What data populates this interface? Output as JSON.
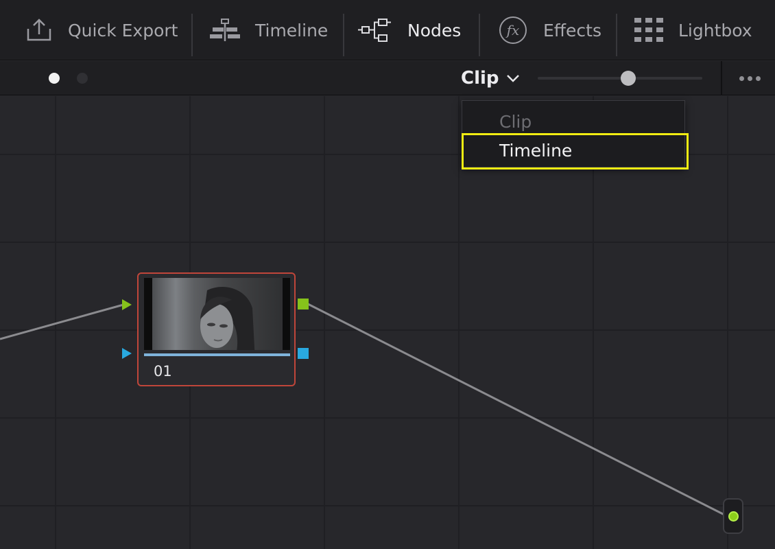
{
  "toolbar": {
    "items": [
      {
        "label": "Quick Export",
        "icon": "quick-export-icon"
      },
      {
        "label": "Timeline",
        "icon": "timeline-icon"
      },
      {
        "label": "Nodes",
        "icon": "nodes-icon",
        "active": true
      },
      {
        "label": "Effects",
        "icon": "fx-icon"
      },
      {
        "label": "Lightbox",
        "icon": "lightbox-icon"
      }
    ]
  },
  "subbar": {
    "mode_value": "Clip",
    "zoom_level": 0.55,
    "page_dots": 2,
    "active_dot": 0
  },
  "dropdown": {
    "options": [
      {
        "label": "Clip",
        "state": "disabled"
      },
      {
        "label": "Timeline",
        "state": "highlighted"
      }
    ]
  },
  "node": {
    "label": "01",
    "border_color": "#c0463a"
  },
  "colors": {
    "rgb_port": "#86c21b",
    "alpha_port": "#29a9e0",
    "highlight": "#f1ec12"
  }
}
